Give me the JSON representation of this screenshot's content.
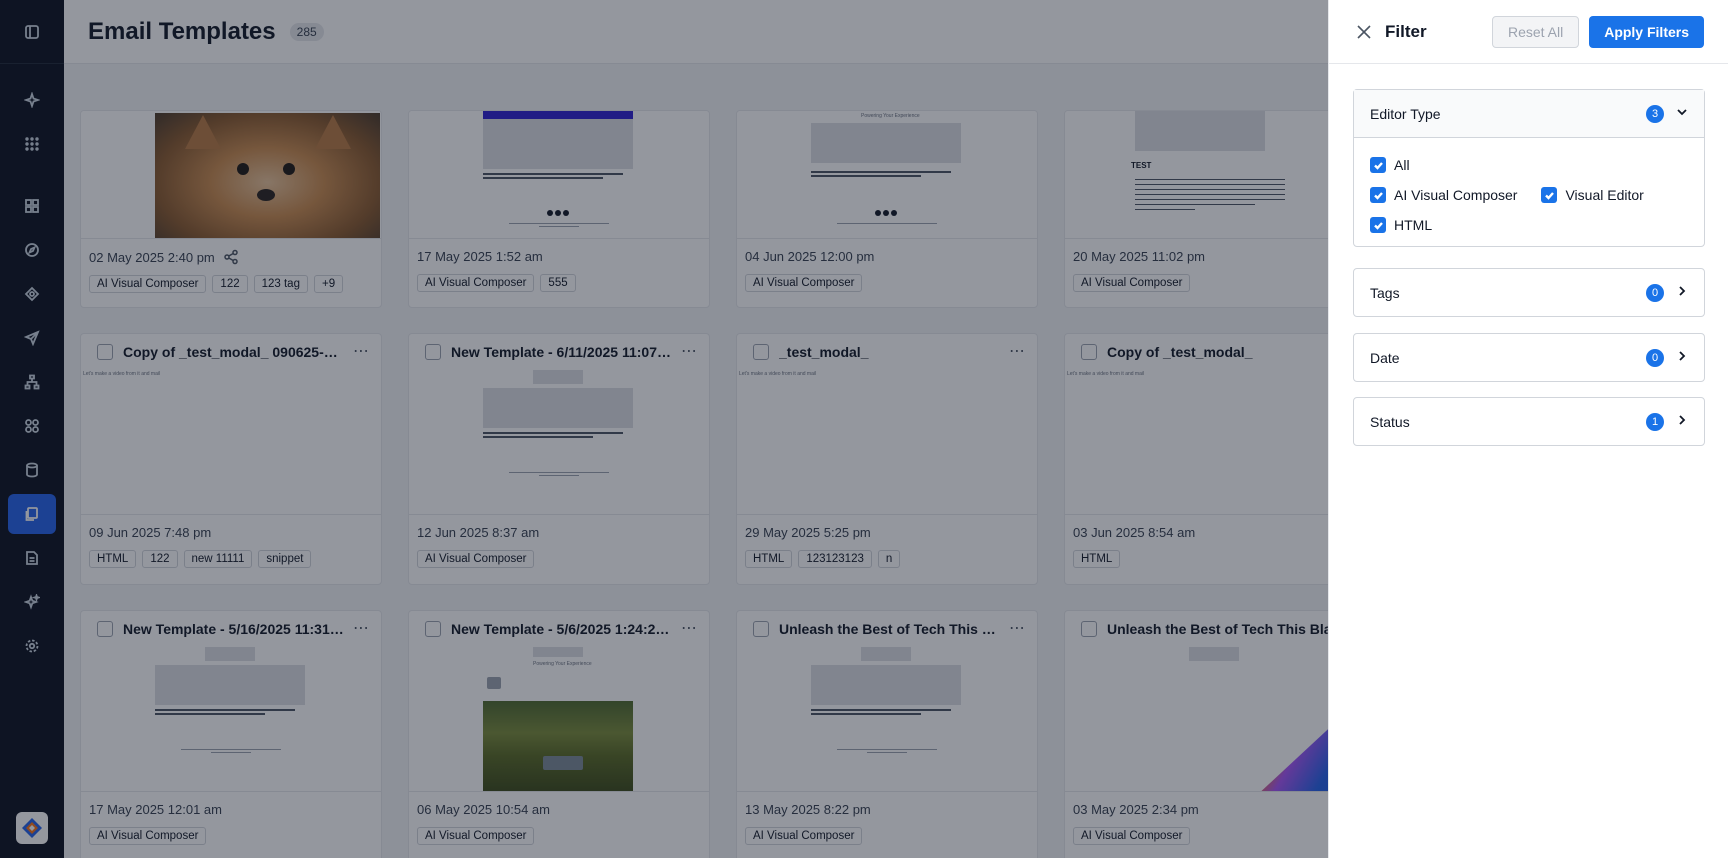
{
  "page": {
    "title": "Email Templates",
    "count": "285"
  },
  "sidebar": {
    "items": [
      {
        "icon": "panel-toggle-icon"
      },
      {
        "icon": "sparkle-icon"
      },
      {
        "icon": "grid-dots-icon"
      },
      {
        "icon": "dashboard-icon"
      },
      {
        "icon": "compass-icon"
      },
      {
        "icon": "target-icon"
      },
      {
        "icon": "send-icon"
      },
      {
        "icon": "hierarchy-icon"
      },
      {
        "icon": "apps-icon"
      },
      {
        "icon": "database-icon"
      },
      {
        "icon": "templates-icon",
        "active": true
      },
      {
        "icon": "document-icon"
      },
      {
        "icon": "ai-icon"
      },
      {
        "icon": "settings-icon"
      }
    ]
  },
  "cards": [
    {
      "title": "",
      "date": "02 May 2025 2:40 pm",
      "tags": [
        "AI Visual Composer",
        "122",
        "123 tag",
        "+9"
      ],
      "share": true
    },
    {
      "title": "",
      "date": "17 May 2025 1:52 am",
      "tags": [
        "AI Visual Composer",
        "555"
      ]
    },
    {
      "title": "",
      "date": "04 Jun 2025 12:00 pm",
      "tags": [
        "AI Visual Composer"
      ]
    },
    {
      "title": "",
      "date": "20 May 2025 11:02 pm",
      "tags": [
        "AI Visual Composer"
      ]
    },
    {
      "title": "Copy of _test_modal_ 090625-141...",
      "date": "09 Jun 2025 7:48 pm",
      "tags": [
        "HTML",
        "122",
        "new 11111",
        "snippet"
      ]
    },
    {
      "title": "New Template - 6/11/2025 11:07:...",
      "date": "12 Jun 2025 8:37 am",
      "tags": [
        "AI Visual Composer"
      ]
    },
    {
      "title": "_test_modal_",
      "date": "29 May 2025 5:25 pm",
      "tags": [
        "HTML",
        "123123123",
        "n"
      ]
    },
    {
      "title": "Copy of _test_modal_",
      "date": "03 Jun 2025 8:54 am",
      "tags": [
        "HTML"
      ]
    },
    {
      "title": "New Template - 5/16/2025 11:31:...",
      "date": "17 May 2025 12:01 am",
      "tags": [
        "AI Visual Composer"
      ]
    },
    {
      "title": "New Template - 5/6/2025 1:24:23 ...",
      "date": "06 May 2025 10:54 am",
      "tags": [
        "AI Visual Composer"
      ]
    },
    {
      "title": "Unleash the Best of Tech This Blac...",
      "date": "13 May 2025 8:22 pm",
      "tags": [
        "AI Visual Composer"
      ]
    },
    {
      "title": "Unleash the Best of Tech This Blac...",
      "date": "03 May 2025 2:34 pm",
      "tags": [
        "AI Visual Composer"
      ]
    }
  ],
  "thumbnails": {
    "powering_text": "Powering Your Experience",
    "test_heading": "TEST",
    "html_snippet": "Let's make a video from it and mail"
  },
  "filter": {
    "title": "Filter",
    "reset_label": "Reset All",
    "apply_label": "Apply Filters",
    "editor_type": {
      "title": "Editor Type",
      "count": "3",
      "options": {
        "all": "All",
        "ai_visual_composer": "AI Visual Composer",
        "visual_editor": "Visual Editor",
        "html": "HTML"
      }
    },
    "tags": {
      "title": "Tags",
      "count": "0"
    },
    "date": {
      "title": "Date",
      "count": "0"
    },
    "status": {
      "title": "Status",
      "count": "1"
    }
  },
  "colors": {
    "accent": "#1a73e8",
    "sidebar_bg": "#0b1220",
    "active_nav": "#2563eb"
  }
}
